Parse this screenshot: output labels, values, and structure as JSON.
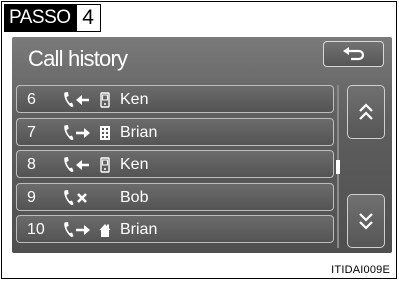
{
  "step_tag": {
    "word": "PASSO",
    "number": "4"
  },
  "screen": {
    "title": "Call history",
    "back_icon": "return-arrow-icon",
    "scroll_up_icon": "double-chevron-up-icon",
    "scroll_down_icon": "double-chevron-down-icon"
  },
  "calls": [
    {
      "index": "6",
      "direction": "incoming",
      "phone": "mobile",
      "name": "Ken"
    },
    {
      "index": "7",
      "direction": "outgoing",
      "phone": "office",
      "name": "Brian"
    },
    {
      "index": "8",
      "direction": "incoming",
      "phone": "mobile",
      "name": "Ken"
    },
    {
      "index": "9",
      "direction": "missed",
      "phone": "none",
      "name": "Bob"
    },
    {
      "index": "10",
      "direction": "outgoing",
      "phone": "home",
      "name": "Brian"
    }
  ],
  "figure_code": "ITIDAI009E"
}
